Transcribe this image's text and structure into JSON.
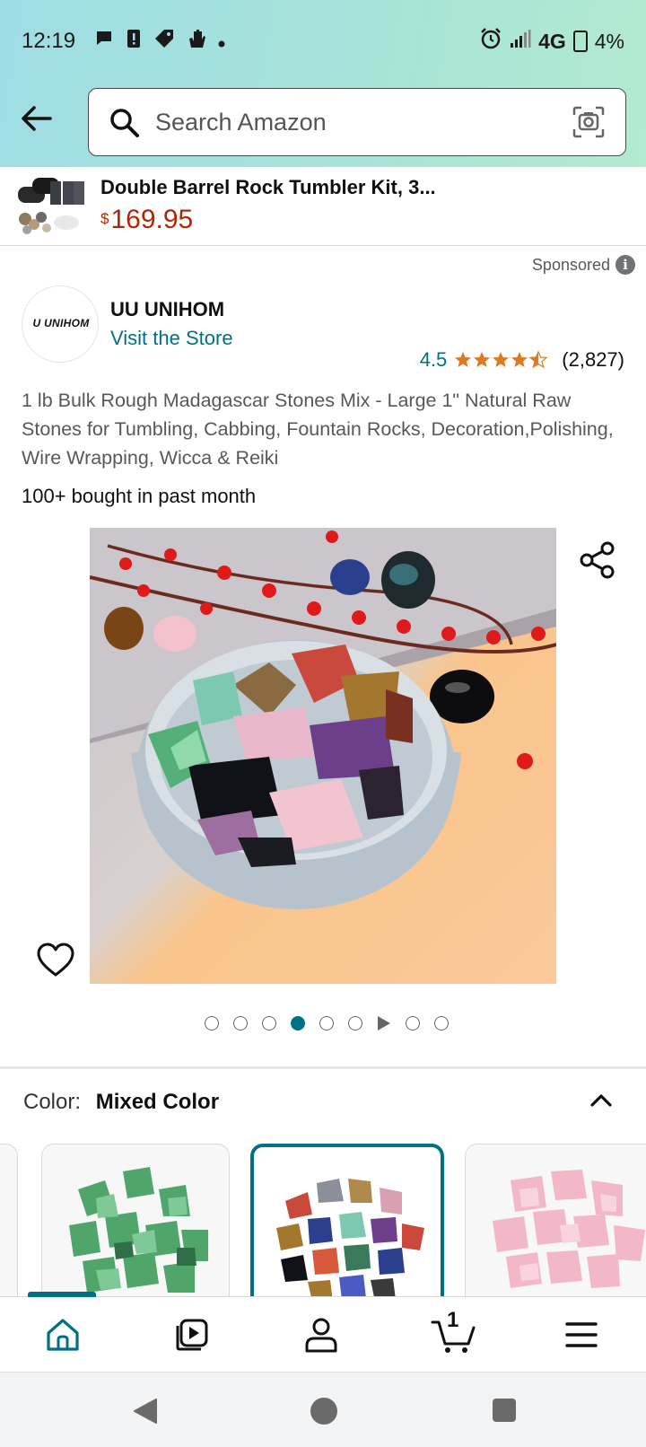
{
  "status_bar": {
    "time": "12:19",
    "network": "4G",
    "battery": "4%"
  },
  "search": {
    "placeholder": "Search Amazon"
  },
  "ad_banner": {
    "title": "Double Barrel Rock Tumbler Kit, 3...",
    "price_symbol": "$",
    "price_value": "169.95"
  },
  "sponsored_label": "Sponsored",
  "brand": {
    "logo_text": "U UNIHOM",
    "name": "UU UNIHOM",
    "visit_store": "Visit the Store"
  },
  "rating": {
    "value": "4.5",
    "stars": 4.5,
    "count": "(2,827)"
  },
  "product": {
    "title": "1 lb Bulk Rough Madagascar Stones Mix - Large 1\" Natural Raw Stones for Tumbling, Cabbing, Fountain Rocks, Decoration,Polishing, Wire Wrapping, Wicca & Reiki",
    "bought_text": "100+ bought in past month"
  },
  "carousel": {
    "total_items": 9,
    "active_index": 3,
    "video_index": 6
  },
  "color_selector": {
    "label": "Color:",
    "value": "Mixed Color",
    "variants": [
      "Green",
      "Mixed Color",
      "Pink"
    ],
    "selected": "Mixed Color"
  },
  "bottom_nav": {
    "items": [
      "home-icon",
      "video-icon",
      "account-icon",
      "cart-icon",
      "menu-icon"
    ],
    "active": "home-icon",
    "cart_count": "1"
  },
  "colors": {
    "accent": "#007185",
    "price": "#B12704",
    "star": "#DE7921"
  }
}
